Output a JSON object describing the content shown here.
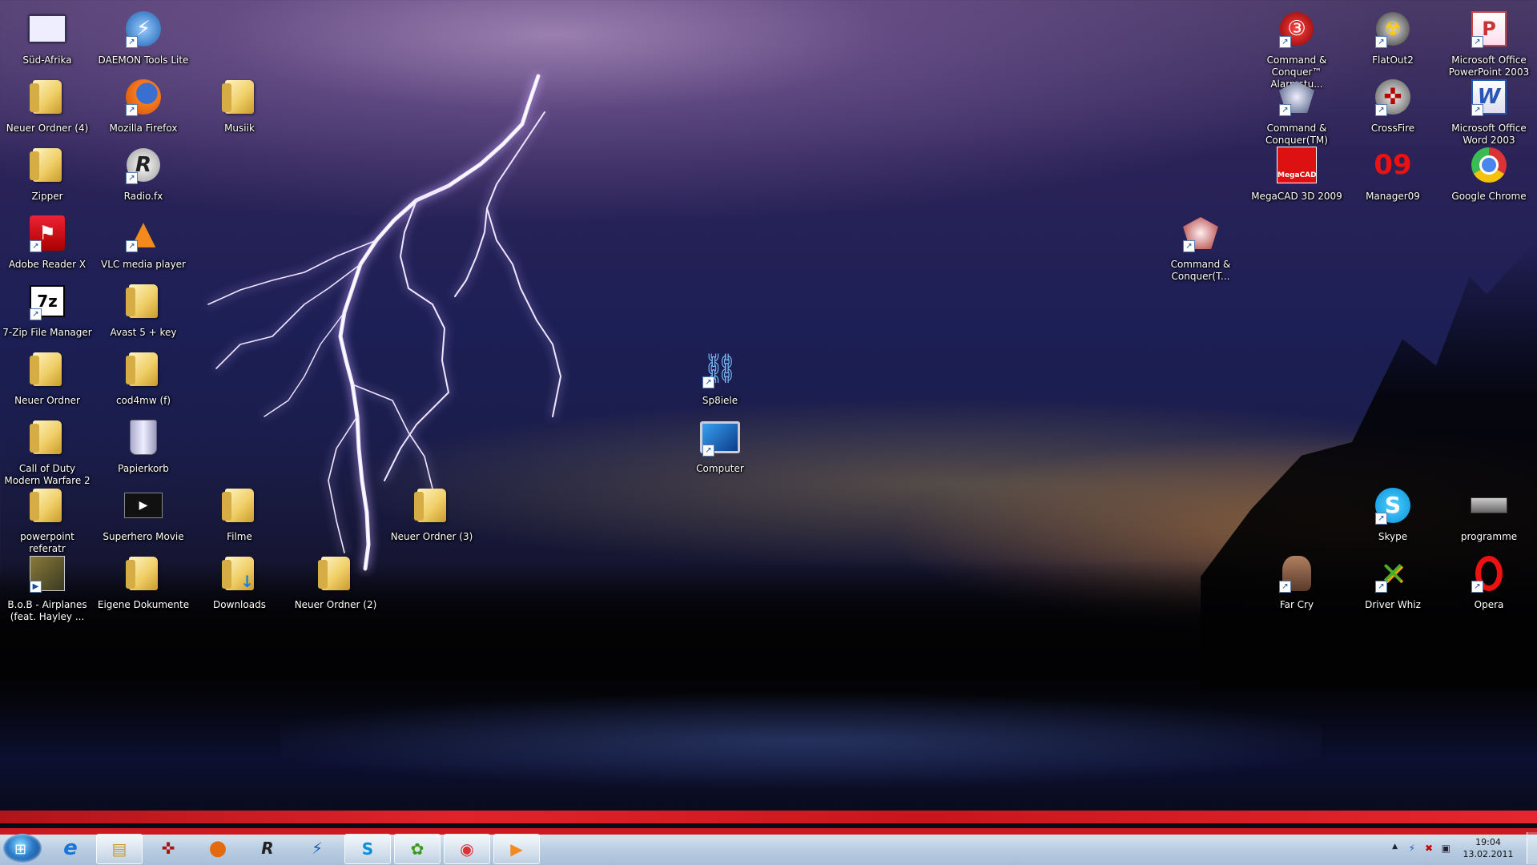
{
  "desktop": {
    "col1": [
      {
        "label": "Süd-Afrika",
        "icon": "document-icon"
      },
      {
        "label": "Neuer Ordner (4)",
        "icon": "folder-icon"
      },
      {
        "label": "Zipper",
        "icon": "folder-icon"
      },
      {
        "label": "Adobe Reader X",
        "icon": "adobe-reader-icon"
      },
      {
        "label": "7-Zip File Manager",
        "icon": "7zip-icon"
      },
      {
        "label": "Neuer Ordner",
        "icon": "folder-icon"
      },
      {
        "label": "Call of Duty  Modern Warfare 2",
        "icon": "folder-icon"
      },
      {
        "label": "powerpoint referatr",
        "icon": "folder-icon"
      },
      {
        "label": "B.o.B - Airplanes (feat. Hayley ...",
        "icon": "media-file-icon"
      }
    ],
    "col2": [
      {
        "label": "DAEMON Tools Lite",
        "icon": "daemon-tools-icon"
      },
      {
        "label": "Mozilla Firefox",
        "icon": "firefox-icon"
      },
      {
        "label": "Radio.fx",
        "icon": "radiofx-icon"
      },
      {
        "label": "VLC media player",
        "icon": "vlc-icon"
      },
      {
        "label": "Avast 5 + key",
        "icon": "folder-icon"
      },
      {
        "label": "cod4mw (f)",
        "icon": "folder-icon"
      },
      {
        "label": "Papierkorb",
        "icon": "recycle-bin-icon"
      },
      {
        "label": "Superhero Movie",
        "icon": "video-file-icon"
      },
      {
        "label": "Eigene Dokumente",
        "icon": "folder-icon"
      }
    ],
    "col3": [
      {
        "label": "Musiik",
        "icon": "folder-icon"
      },
      {
        "label": "Filme",
        "icon": "folder-icon"
      },
      {
        "label": "Downloads",
        "icon": "downloads-folder-icon"
      }
    ],
    "misc": [
      {
        "label": "Neuer Ordner (2)",
        "icon": "folder-icon"
      },
      {
        "label": "Neuer Ordner (3)",
        "icon": "folder-icon"
      },
      {
        "label": "Sp8iele",
        "icon": "network-icon"
      },
      {
        "label": "Computer",
        "icon": "computer-icon"
      }
    ],
    "right": [
      {
        "label": "Command & Conquer™ Alarmstu...",
        "icon": "cnc-red-alert-icon"
      },
      {
        "label": "FlatOut2",
        "icon": "flatout-icon"
      },
      {
        "label": "Microsoft Office PowerPoint 2003",
        "icon": "powerpoint-icon"
      },
      {
        "label": "Command & Conquer(TM) Gen...",
        "icon": "cnc-generals-icon"
      },
      {
        "label": "CrossFire",
        "icon": "crossfire-icon"
      },
      {
        "label": "Microsoft Office Word 2003",
        "icon": "word-icon"
      },
      {
        "label": "MegaCAD 3D 2009",
        "icon": "megacad-icon"
      },
      {
        "label": "Manager09",
        "icon": "manager09-icon"
      },
      {
        "label": "Google Chrome",
        "icon": "chrome-icon"
      },
      {
        "label": "Command & Conquer(T...",
        "icon": "cnc-generals-icon"
      },
      {
        "label": "Skype",
        "icon": "skype-icon"
      },
      {
        "label": "programme",
        "icon": "chip-icon"
      },
      {
        "label": "Far Cry",
        "icon": "farcry-icon"
      },
      {
        "label": "Driver Whiz",
        "icon": "driverwhiz-icon"
      },
      {
        "label": "Opera",
        "icon": "opera-icon"
      }
    ]
  },
  "icon_glyphs": {
    "daemon": "⚡",
    "firefox": "●",
    "radiofx": "R",
    "vlc": "▲",
    "bin": "🗑",
    "video": "▶",
    "adobe": "⚑",
    "sevenzip": "7z",
    "network": "⛓",
    "computer": "▣",
    "cnc": "③",
    "flatout": "☢",
    "ppt": "P",
    "crossfire": "✜",
    "word": "W",
    "megacad": "MegaCAD",
    "manager": "09",
    "chrome": "◉",
    "skype": "S",
    "chip": "▤",
    "farcry": "☺",
    "driverwhiz": "✕",
    "opera": "O"
  },
  "taskbar": {
    "start_glyph": "⊞",
    "items": [
      {
        "name": "internet-explorer",
        "glyph": "e"
      },
      {
        "name": "windows-explorer",
        "glyph": "▤"
      },
      {
        "name": "crossfire",
        "glyph": "✜"
      },
      {
        "name": "firefox",
        "glyph": "●"
      },
      {
        "name": "radiofx",
        "glyph": "R"
      },
      {
        "name": "daemon-tools",
        "glyph": "⚡"
      },
      {
        "name": "skype",
        "glyph": "S"
      },
      {
        "name": "icq",
        "glyph": "✿"
      },
      {
        "name": "chrome",
        "glyph": "◉"
      },
      {
        "name": "media-player",
        "glyph": "▶"
      }
    ],
    "tray": {
      "up_arrow": "▲",
      "time": "19:04",
      "date": "13.02.2011"
    }
  },
  "colors": {
    "accent_red": "#c91b21",
    "taskbar": "#b9cde2"
  }
}
